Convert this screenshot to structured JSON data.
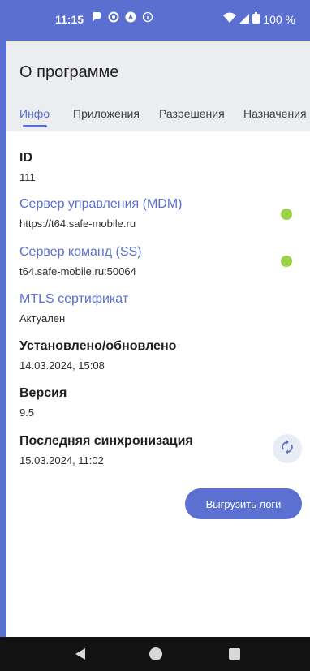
{
  "status_bar": {
    "time": "11:15",
    "battery": "100 %",
    "icons": [
      "chat-icon",
      "circle-icon",
      "nav-icon",
      "info-icon",
      "wifi-icon",
      "signal-icon",
      "battery-icon"
    ]
  },
  "app": {
    "title": "О программе",
    "tabs": [
      {
        "label": "Инфо",
        "active": true
      },
      {
        "label": "Приложения",
        "active": false
      },
      {
        "label": "Разрешения",
        "active": false
      },
      {
        "label": "Назначения",
        "active": false
      }
    ],
    "fields": {
      "id": {
        "label": "ID",
        "value": "111"
      },
      "mdm": {
        "label": "Сервер управления (MDM)",
        "value": "https://t64.safe-mobile.ru",
        "status_color": "#9bd24a"
      },
      "ss": {
        "label": "Сервер команд (SS)",
        "value": "t64.safe-mobile.ru:50064",
        "status_color": "#9bd24a"
      },
      "mtls": {
        "label": "MTLS сертификат",
        "value": "Актуален"
      },
      "installed": {
        "label": "Установлено/обновлено",
        "value": "14.03.2024, 15:08"
      },
      "version": {
        "label": "Версия",
        "value": "9.5"
      },
      "last_sync": {
        "label": "Последняя синхронизация",
        "value": "15.03.2024, 11:02"
      }
    },
    "sync_button_icon": "sync-icon",
    "export_logs_label": "Выгрузить логи"
  },
  "colors": {
    "accent": "#5a6fcf",
    "status_green": "#9bd24a",
    "statusbar": "#5b6fd0"
  }
}
